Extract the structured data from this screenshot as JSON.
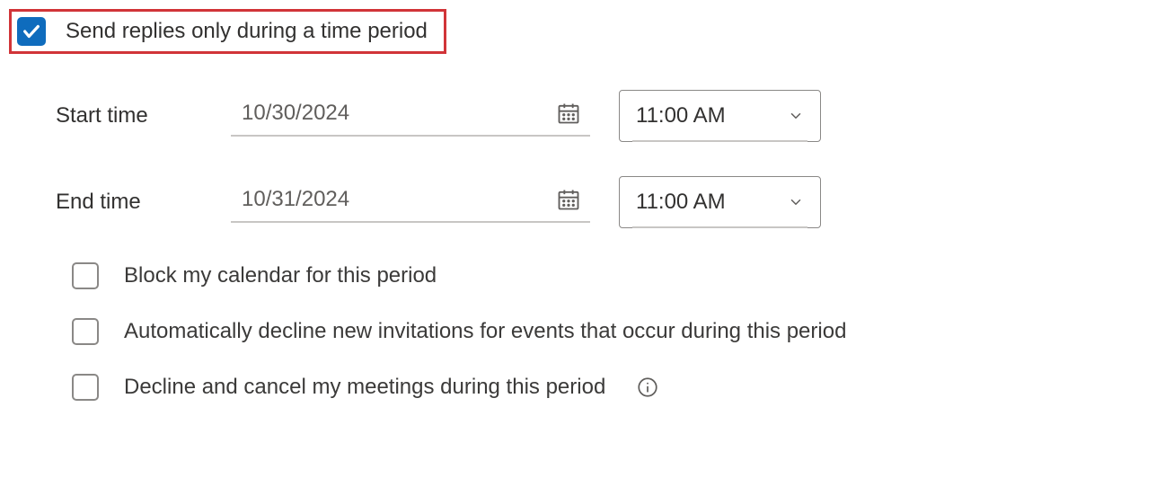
{
  "main": {
    "send_replies_label": "Send replies only during a time period",
    "start_time_label": "Start time",
    "start_date_value": "10/30/2024",
    "start_time_value": "11:00 AM",
    "end_time_label": "End time",
    "end_date_value": "10/31/2024",
    "end_time_value": "11:00 AM"
  },
  "options": {
    "block_calendar": "Block my calendar for this period",
    "auto_decline": "Automatically decline new invitations for events that occur during this period",
    "decline_cancel": "Decline and cancel my meetings during this period"
  },
  "state": {
    "send_replies_checked": true,
    "block_calendar_checked": false,
    "auto_decline_checked": false,
    "decline_cancel_checked": false
  }
}
